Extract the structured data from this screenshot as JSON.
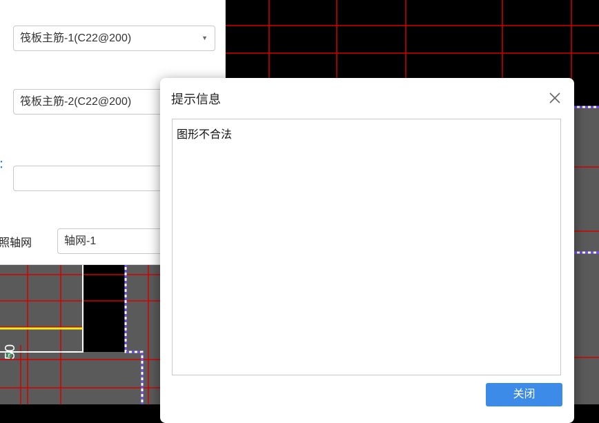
{
  "colors": {
    "canvas_black": "#000000",
    "canvas_gray": "#5a5a5a",
    "grid_red": "#d60000",
    "outline_yellow": "#f2ef1f",
    "outline_white": "#ffffff",
    "dashed_purple": "#7b4dff",
    "button_blue": "#3c8be9",
    "label_blue": "#1a73e8"
  },
  "panel": {
    "rebar1_value": "筏板主筋-1(C22@200)",
    "rebar2_value": "筏板主筋-2(C22@200)",
    "ref_axis_label": "照轴网",
    "axis_value": "轴网-1",
    "cut_label_fragment": "：",
    "dropdown_icon": "caret-down-icon"
  },
  "canvas": {
    "dimension_text": "50"
  },
  "dialog": {
    "title": "提示信息",
    "message": "图形不合法",
    "close_button": "关闭",
    "close_icon": "close-icon"
  }
}
